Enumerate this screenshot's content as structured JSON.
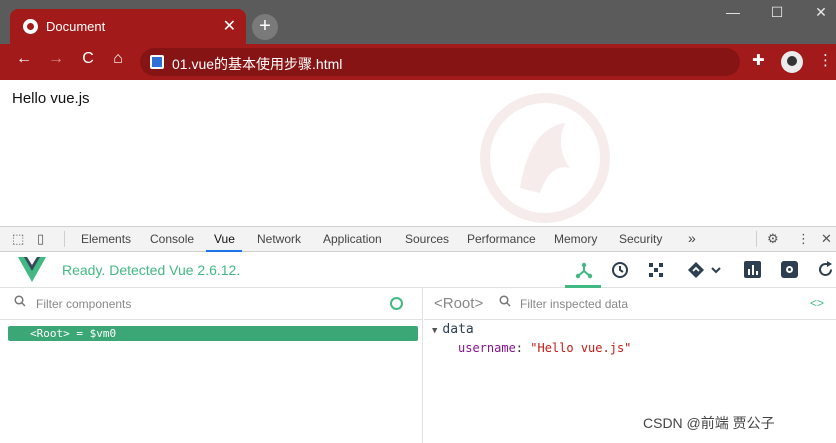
{
  "browser": {
    "tab": {
      "title": "Document",
      "favicon": "chrome-tab-icon",
      "close": "✕"
    },
    "new_tab": "+",
    "window_controls": {
      "minimize": "—",
      "maximize": "☐",
      "close": "✕"
    },
    "nav": {
      "back": "←",
      "forward": "→",
      "reload": "C",
      "home": "⌂"
    },
    "address": {
      "url": "01.vue的基本使用步骤.html",
      "site_icon": "file-icon"
    },
    "toolbar_icons": {
      "extensions": "✚",
      "profile": "profile-avatar",
      "menu": "⋮"
    }
  },
  "page": {
    "text": "Hello vue.js"
  },
  "devtools": {
    "tabs": [
      "Elements",
      "Console",
      "Vue",
      "Network",
      "Application",
      "Sources",
      "Performance",
      "Memory",
      "Security"
    ],
    "active_tab": "Vue",
    "more": "»",
    "settings": "⚙",
    "menu": "⋮",
    "close": "✕"
  },
  "vue": {
    "status": "Ready. Detected Vue 2.6.12.",
    "brand_color": "#42b983",
    "toolbar_icons": [
      "components-icon",
      "history-icon",
      "vuex-icon",
      "events-icon",
      "chevron-down-icon",
      "perf-icon",
      "settings-icon",
      "refresh-icon"
    ],
    "filter_placeholder": "Filter components",
    "root_node": "<Root> = $vm0",
    "inspect_label": "<Root>",
    "inspect_placeholder": "Filter inspected data",
    "code_icon": "<>",
    "data_section": "data",
    "data_key": "username",
    "data_value": "\"Hello vue.js\""
  },
  "watermark": "CSDN @前端 贾公子"
}
